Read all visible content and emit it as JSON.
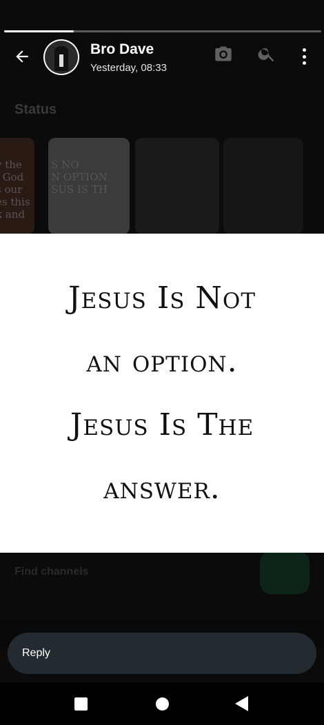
{
  "header": {
    "name": "Bro Dave",
    "timestamp": "Yesterday, 08:33"
  },
  "progress": {
    "fraction": 0.22
  },
  "status_image": {
    "lines": [
      "Jesus is not",
      "an option.",
      "Jesus is the",
      "answer."
    ]
  },
  "background": {
    "section_title": "Status",
    "card_text_1": "y the\nl God\ns our\nes this\nk and",
    "card_text_2": "S NO\nN OPTION\nSUS IS TH",
    "find_channels": "Find channels"
  },
  "reply": {
    "label": "Reply"
  },
  "icons": {
    "back": "arrow-left-icon",
    "camera": "camera-icon",
    "search": "search-icon",
    "more": "more-vertical-icon"
  }
}
